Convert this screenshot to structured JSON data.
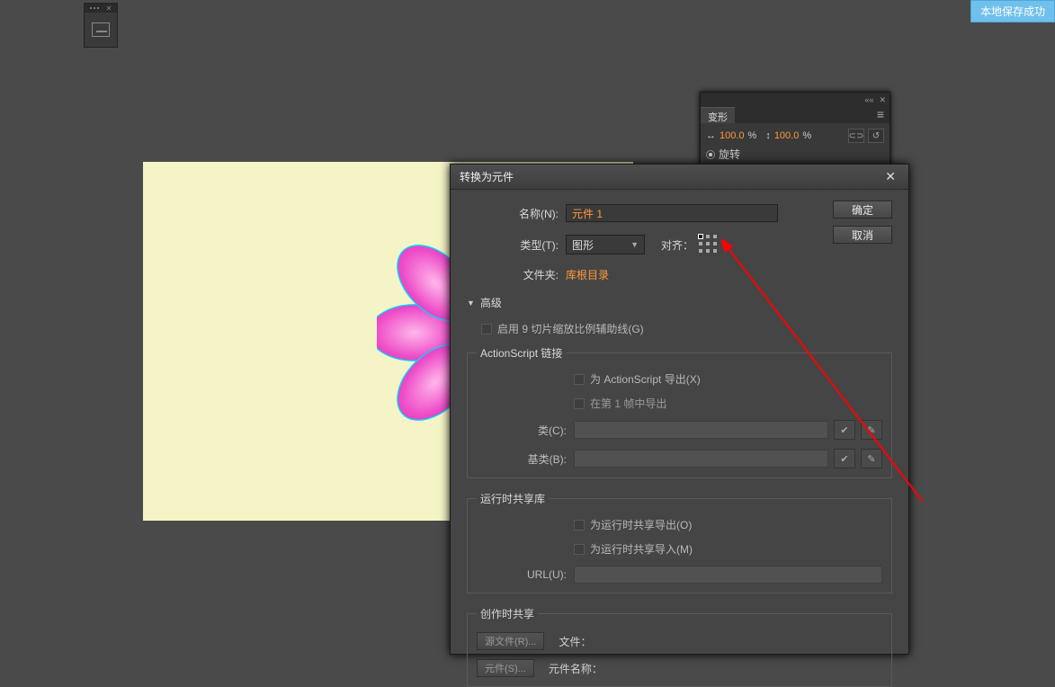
{
  "toast": "本地保存成功",
  "transform": {
    "tab": "变形",
    "w_val": "100.0",
    "h_val": "100.0",
    "percent": "%",
    "rotate_label": "旋转"
  },
  "dialog": {
    "title": "转换为元件",
    "ok": "确定",
    "cancel": "取消",
    "name_label": "名称(N):",
    "name_value": "元件 1",
    "type_label": "类型(T):",
    "type_value": "图形",
    "align_label": "对齐：",
    "folder_label": "文件夹:",
    "folder_value": "库根目录",
    "advanced": "高级",
    "enable9slice": "启用 9 切片缩放比例辅助线(G)",
    "as_legend": "ActionScript 链接",
    "export_for_as": "为 ActionScript 导出(X)",
    "export_frame1": "在第 1 帧中导出",
    "class_label": "类(C):",
    "base_label": "基类(B):",
    "runtime_legend": "运行时共享库",
    "runtime_export": "为运行时共享导出(O)",
    "runtime_import": "为运行时共享导入(M)",
    "url_label": "URL(U):",
    "authoring_legend": "创作时共享",
    "src_btn": "源文件(R)...",
    "file_label": "文件：",
    "symbol_btn": "元件(S)...",
    "symbol_name_label": "元件名称："
  }
}
